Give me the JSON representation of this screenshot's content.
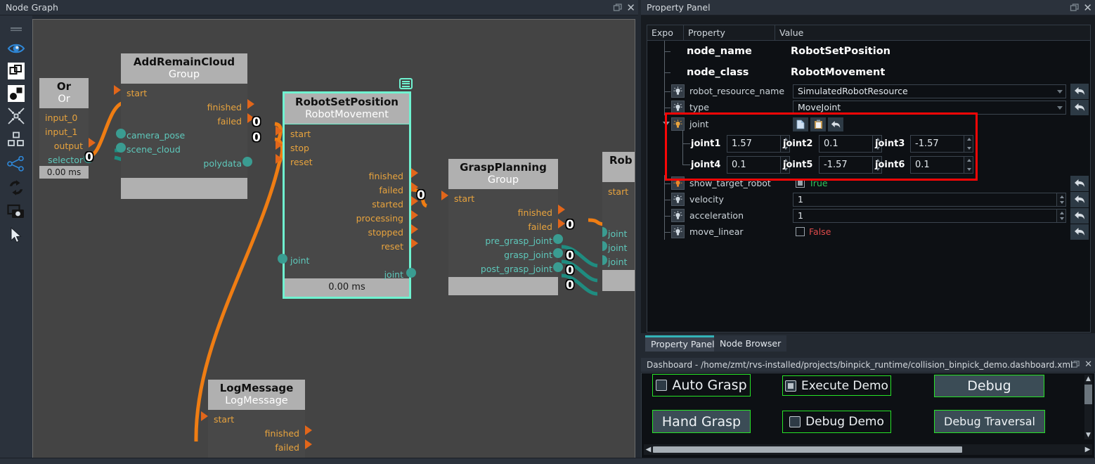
{
  "graph_panel": {
    "title": "Node Graph",
    "window_buttons": [
      "restore-icon",
      "close-icon"
    ],
    "toolbar_icons": [
      "grip-handle-icon",
      "eye-icon",
      "select-all-icon",
      "group-nodes-icon",
      "collapse-icon",
      "layout-icon",
      "share-graph-icon",
      "refresh-icon",
      "screenshot-icon",
      "cursor-icon"
    ],
    "nodes": [
      {
        "id": "or",
        "title": "Or",
        "subtitle": "Or",
        "footer": "0.00 ms",
        "inputs_exec": [],
        "inputs_data": [],
        "left_labels": [
          "input_0",
          "input_1"
        ],
        "right_labels": [
          "output",
          "selector"
        ],
        "selected": false
      },
      {
        "id": "addremaincloud",
        "title": "AddRemainCloud",
        "subtitle": "Group",
        "footer": "",
        "left_labels": [
          "start",
          "camera_pose",
          "scene_cloud"
        ],
        "right_labels": [
          "finished",
          "failed",
          "polydata"
        ],
        "selected": false
      },
      {
        "id": "robotsetposition",
        "title": "RobotSetPosition",
        "subtitle": "RobotMovement",
        "footer": "0.00 ms",
        "left_labels": [
          "start",
          "stop",
          "reset",
          "joint"
        ],
        "right_labels": [
          "finished",
          "failed",
          "started",
          "processing",
          "stopped",
          "reset",
          "joint"
        ],
        "selected": true
      },
      {
        "id": "graspplanning",
        "title": "GraspPlanning",
        "subtitle": "Group",
        "footer": "",
        "left_labels": [
          "start"
        ],
        "right_labels": [
          "finished",
          "failed",
          "pre_grasp_joint",
          "grasp_joint",
          "post_grasp_joint"
        ],
        "selected": false
      },
      {
        "id": "robpartial",
        "title": "Rob",
        "subtitle": "",
        "footer": "",
        "left_labels": [
          "start",
          "joint",
          "joint",
          "joint"
        ],
        "right_labels": [],
        "selected": false
      },
      {
        "id": "logmessage",
        "title": "LogMessage",
        "subtitle": "LogMessage",
        "footer": "",
        "left_labels": [
          "start"
        ],
        "right_labels": [
          "finished",
          "failed"
        ],
        "selected": false
      }
    ],
    "edge_badges": [
      "0",
      "0",
      "0",
      "0",
      "0",
      "0",
      "0",
      "0"
    ]
  },
  "property_panel": {
    "title": "Property Panel",
    "window_buttons": [
      "restore-icon",
      "close-icon"
    ],
    "columns": [
      "Expo",
      "Property",
      "Value"
    ],
    "rows": [
      {
        "name": "node_name",
        "value": "RobotSetPosition",
        "kind": "bold"
      },
      {
        "name": "node_class",
        "value": "RobotMovement",
        "kind": "bold"
      },
      {
        "name": "robot_resource_name",
        "value": "SimulatedRobotResource",
        "kind": "combo"
      },
      {
        "name": "type",
        "value": "MoveJoint",
        "kind": "combo"
      },
      {
        "name": "joint",
        "value": "",
        "kind": "group"
      },
      {
        "name": "show_target_robot",
        "value": "True",
        "kind": "check-true"
      },
      {
        "name": "velocity",
        "value": "1",
        "kind": "spin"
      },
      {
        "name": "acceleration",
        "value": "1",
        "kind": "spin"
      },
      {
        "name": "move_linear",
        "value": "False",
        "kind": "check-false"
      }
    ],
    "joint_tool_icons": [
      "copy-icon",
      "paste-icon",
      "revert-icon"
    ],
    "joints": [
      {
        "label": "joint1",
        "value": "1.57"
      },
      {
        "label": "joint2",
        "value": "0.1"
      },
      {
        "label": "joint3",
        "value": "-1.57"
      },
      {
        "label": "joint4",
        "value": "0.1"
      },
      {
        "label": "joint5",
        "value": "-1.57"
      },
      {
        "label": "joint6",
        "value": "0.1"
      }
    ],
    "highlight_color": "#fb0606",
    "tabs": [
      {
        "label": "Property Panel",
        "active": true
      },
      {
        "label": "Node Browser",
        "active": false
      }
    ]
  },
  "dashboard": {
    "title": "Dashboard - /home/zmt/rvs-installed/projects/binpick_runtime/collision_binpick_demo.dashboard.xml",
    "window_buttons": [
      "restore-icon",
      "close-icon"
    ],
    "controls": [
      {
        "label": "Auto Grasp",
        "type": "checkbox",
        "checked": false,
        "filled": false
      },
      {
        "label": "Execute Demo",
        "type": "checkbox",
        "checked": true,
        "filled": false
      },
      {
        "label": "Debug",
        "type": "button",
        "checked": false,
        "filled": true
      },
      {
        "label": "Hand Grasp",
        "type": "button",
        "checked": false,
        "filled": true
      },
      {
        "label": "Debug Demo",
        "type": "checkbox",
        "checked": false,
        "filled": false
      },
      {
        "label": "Debug Traversal",
        "type": "button",
        "checked": false,
        "filled": true
      }
    ],
    "accent_border": "#27e327"
  }
}
